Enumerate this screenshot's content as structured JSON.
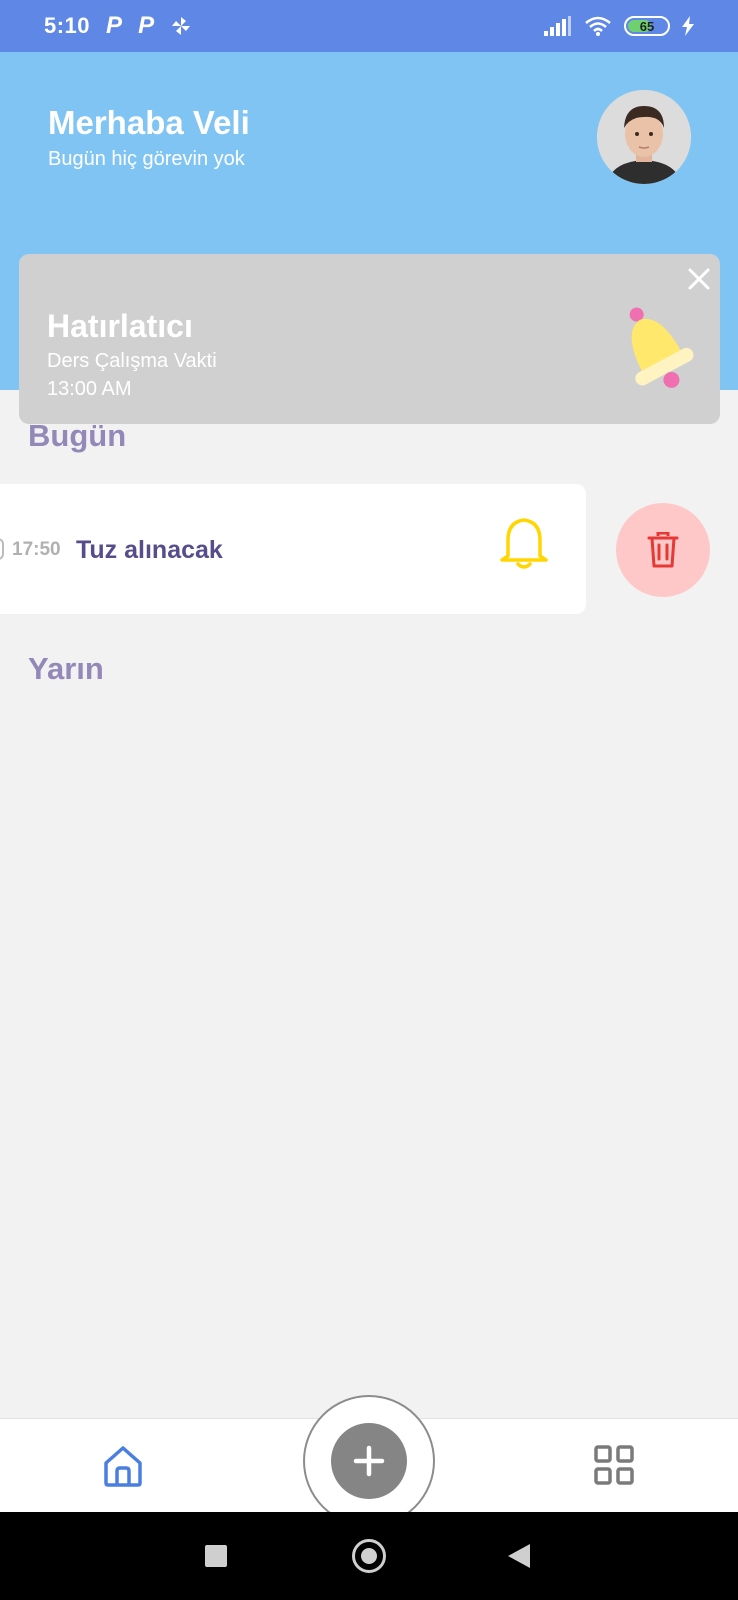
{
  "status_bar": {
    "time": "5:10",
    "battery_level": "65",
    "battery_fraction": 0.65,
    "icons": [
      "p-app-icon",
      "p-app-icon",
      "pinwheel-icon",
      "signal-icon",
      "wifi-icon",
      "battery-icon",
      "charging-icon"
    ]
  },
  "header": {
    "greeting": "Merhaba Veli",
    "subtitle": "Bugün hiç görevin yok"
  },
  "reminder": {
    "title": "Hatırlatıcı",
    "description": "Ders Çalışma Vakti",
    "time": "13:00 AM"
  },
  "sections": {
    "today": "Bugün",
    "tomorrow": "Yarın"
  },
  "tasks": [
    {
      "time": "17:50",
      "title": "Tuz alınacak"
    }
  ],
  "colors": {
    "status_bar": "#5f88e6",
    "header": "#80c4f4",
    "section_title": "#9488b8",
    "task_title": "#574d8a",
    "bell_yellow": "#ffd600",
    "delete_bg": "#ffc8c8",
    "delete_icon": "#e53935"
  },
  "nav": {
    "items": [
      "home-icon",
      "add-icon",
      "grid-icon"
    ]
  }
}
